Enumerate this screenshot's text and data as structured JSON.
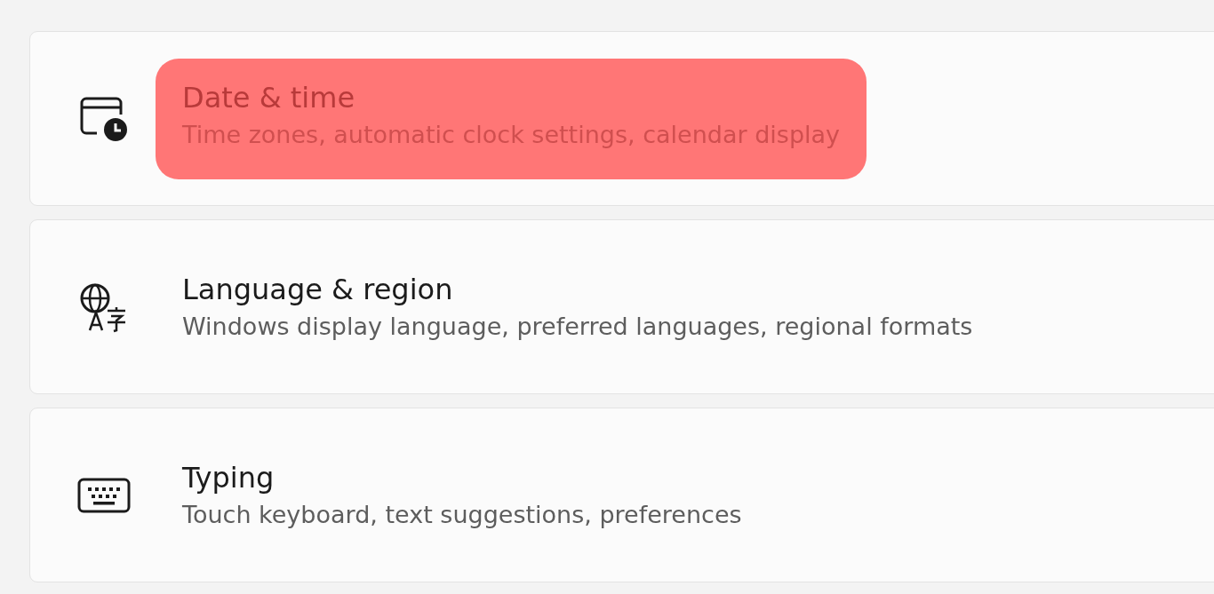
{
  "items": [
    {
      "kind": "date",
      "title": "Date & time",
      "subtitle": "Time zones, automatic clock settings, calendar display",
      "highlighted": true
    },
    {
      "kind": "language",
      "title": "Language & region",
      "subtitle": "Windows display language, preferred languages, regional formats",
      "highlighted": false
    },
    {
      "kind": "typing",
      "title": "Typing",
      "subtitle": "Touch keyboard, text suggestions, preferences",
      "highlighted": false
    }
  ]
}
